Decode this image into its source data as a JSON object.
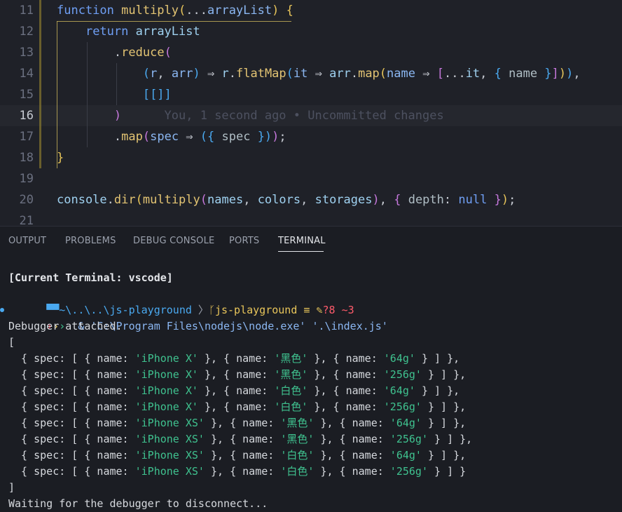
{
  "editor": {
    "lines": [
      {
        "num": "11",
        "tokens": [
          [
            "kw",
            "function "
          ],
          [
            "fn",
            "multiply"
          ],
          [
            "b1",
            "("
          ],
          [
            "op",
            "..."
          ],
          [
            "pl",
            "arrayList"
          ],
          [
            "b1",
            ")"
          ],
          [
            "op",
            " "
          ],
          [
            "b1",
            "{"
          ]
        ]
      },
      {
        "num": "12",
        "tokens": [
          [
            "op",
            "    "
          ],
          [
            "kw",
            "return "
          ],
          [
            "vr",
            "arrayList"
          ]
        ]
      },
      {
        "num": "13",
        "tokens": [
          [
            "op",
            "        "
          ],
          [
            "op",
            "."
          ],
          [
            "fn",
            "reduce"
          ],
          [
            "b2",
            "("
          ]
        ]
      },
      {
        "num": "14",
        "tokens": [
          [
            "op",
            "            "
          ],
          [
            "b3",
            "("
          ],
          [
            "pl",
            "r"
          ],
          [
            "op",
            ", "
          ],
          [
            "pl",
            "arr"
          ],
          [
            "b3",
            ")"
          ],
          [
            "op",
            " ⇒ "
          ],
          [
            "vr",
            "r"
          ],
          [
            "op",
            "."
          ],
          [
            "fn",
            "flatMap"
          ],
          [
            "b3",
            "("
          ],
          [
            "pl",
            "it"
          ],
          [
            "op",
            " ⇒ "
          ],
          [
            "vr",
            "arr"
          ],
          [
            "op",
            "."
          ],
          [
            "fn",
            "map"
          ],
          [
            "b1",
            "("
          ],
          [
            "pl",
            "name"
          ],
          [
            "op",
            " ⇒ "
          ],
          [
            "b2",
            "["
          ],
          [
            "op",
            "..."
          ],
          [
            "vr",
            "it"
          ],
          [
            "op",
            ", "
          ],
          [
            "b3",
            "{ "
          ],
          [
            "pr",
            "name"
          ],
          [
            "b3",
            " }"
          ],
          [
            "b2",
            "]"
          ],
          [
            "b1",
            ")"
          ],
          [
            "b3",
            ")"
          ],
          [
            "op",
            ","
          ]
        ]
      },
      {
        "num": "15",
        "tokens": [
          [
            "op",
            "            "
          ],
          [
            "b3",
            "[[]]"
          ]
        ]
      },
      {
        "num": "16",
        "tokens": [
          [
            "op",
            "        "
          ],
          [
            "b2",
            ")"
          ]
        ],
        "ghost": "      You, 1 second ago • Uncommitted changes",
        "current": true
      },
      {
        "num": "17",
        "tokens": [
          [
            "op",
            "        "
          ],
          [
            "op",
            "."
          ],
          [
            "fn",
            "map"
          ],
          [
            "b2",
            "("
          ],
          [
            "pl",
            "spec"
          ],
          [
            "op",
            " ⇒ "
          ],
          [
            "b3",
            "({ "
          ],
          [
            "pr",
            "spec"
          ],
          [
            "b3",
            " })"
          ],
          [
            "b2",
            ")"
          ],
          [
            "op",
            ";"
          ]
        ]
      },
      {
        "num": "18",
        "tokens": [
          [
            "b1",
            "}"
          ]
        ]
      },
      {
        "num": "19",
        "tokens": []
      },
      {
        "num": "20",
        "tokens": [
          [
            "vr",
            "console"
          ],
          [
            "op",
            "."
          ],
          [
            "fn",
            "dir"
          ],
          [
            "b1",
            "("
          ],
          [
            "fn",
            "multiply"
          ],
          [
            "b2",
            "("
          ],
          [
            "vr",
            "names"
          ],
          [
            "op",
            ", "
          ],
          [
            "vr",
            "colors"
          ],
          [
            "op",
            ", "
          ],
          [
            "vr",
            "storages"
          ],
          [
            "b2",
            ")"
          ],
          [
            "op",
            ", "
          ],
          [
            "b2",
            "{ "
          ],
          [
            "pr",
            "depth"
          ],
          [
            "op",
            ": "
          ],
          [
            "nul",
            "null"
          ],
          [
            "b2",
            " }"
          ],
          [
            "b1",
            ")"
          ],
          [
            "op",
            ";"
          ]
        ]
      },
      {
        "num": "21",
        "tokens": []
      }
    ]
  },
  "panel": {
    "tabs": [
      "OUTPUT",
      "PROBLEMS",
      "DEBUG CONSOLE",
      "PORTS",
      "TERMINAL"
    ],
    "active_tab": "TERMINAL"
  },
  "terminal": {
    "current_terminal": "[Current Terminal: vscode]",
    "prompt_path": "~\\..\\..\\js-playground",
    "prompt_branch": "js-playground",
    "prompt_status_eq": "≡",
    "prompt_status_changes": "?8 ~3",
    "command": "& 'C:\\Program Files\\nodejs\\node.exe' '.\\index.js'",
    "debugger_attached": "Debugger attached.",
    "open_bracket": "[",
    "close_bracket": "]",
    "results": [
      {
        "model": "'iPhone X'",
        "color": "黑色",
        "storage": "'64g'"
      },
      {
        "model": "'iPhone X'",
        "color": "黑色",
        "storage": "'256g'"
      },
      {
        "model": "'iPhone X'",
        "color": "白色",
        "storage": "'64g'"
      },
      {
        "model": "'iPhone X'",
        "color": "白色",
        "storage": "'256g'"
      },
      {
        "model": "'iPhone XS'",
        "color": "黑色",
        "storage": "'64g'"
      },
      {
        "model": "'iPhone XS'",
        "color": "黑色",
        "storage": "'256g'"
      },
      {
        "model": "'iPhone XS'",
        "color": "白色",
        "storage": "'64g'"
      },
      {
        "model": "'iPhone XS'",
        "color": "白色",
        "storage": "'256g'"
      }
    ],
    "waiting": "Waiting for the debugger to disconnect..."
  }
}
